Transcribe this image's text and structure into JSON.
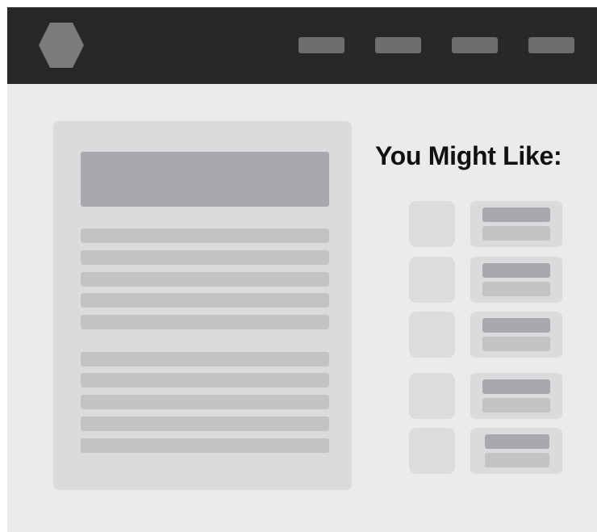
{
  "header": {
    "logo_icon": "hexagon-logo-icon",
    "nav_items": [
      "nav-1",
      "nav-2",
      "nav-3",
      "nav-4"
    ]
  },
  "sidebar": {
    "heading": "You Might Like:",
    "recommendations": [
      "rec-1",
      "rec-2",
      "rec-3",
      "rec-4",
      "rec-5"
    ]
  },
  "colors": {
    "topbar": "#282828",
    "page_bg": "#ebebeb",
    "card_bg": "#dbdbde",
    "placeholder_dark": "#aaa8ac",
    "placeholder_light": "#c5c2c6",
    "nav_placeholder": "#6e6e6e",
    "logo": "#7b7b7b"
  }
}
